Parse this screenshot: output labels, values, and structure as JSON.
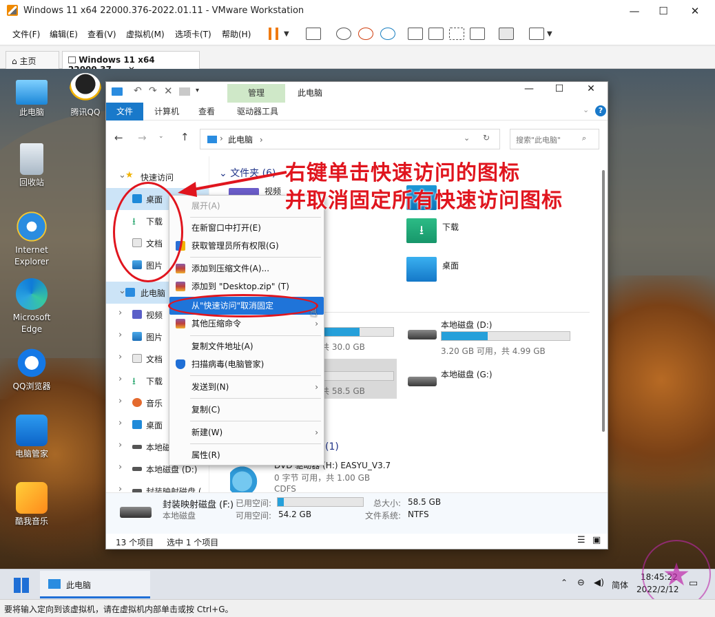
{
  "vm": {
    "title": "Windows 11 x64 22000.376-2022.01.11 - VMware Workstation",
    "menu": [
      "文件(F)",
      "编辑(E)",
      "查看(V)",
      "虚拟机(M)",
      "选项卡(T)",
      "帮助(H)"
    ],
    "tabs": [
      {
        "label": "主页"
      },
      {
        "label": "Windows 11 x64 22000.37..."
      }
    ],
    "status_text": "要将输入定向到该虚拟机，请在虚拟机内部单击或按 Ctrl+G。"
  },
  "desktop": {
    "icons": [
      {
        "label": "此电脑"
      },
      {
        "label": "腾讯QQ"
      },
      {
        "label": "回收站"
      },
      {
        "label": "Internet Explorer"
      },
      {
        "label": "Microsoft Edge"
      },
      {
        "label": "QQ浏览器"
      },
      {
        "label": "电脑管家"
      },
      {
        "label": "酷我音乐"
      }
    ]
  },
  "explorer": {
    "manage_tab": "管理",
    "window_title": "此电脑",
    "ribbon_tabs": [
      "文件",
      "计算机",
      "查看",
      "驱动器工具"
    ],
    "address": "此电脑",
    "search_placeholder": "搜索\"此电脑\"",
    "nav": {
      "quick_access": "快速访问",
      "quick_items": [
        "桌面",
        "下载",
        "文档",
        "图片"
      ],
      "this_pc": "此电脑",
      "pc_items": [
        "视频",
        "图片",
        "文档",
        "下载",
        "音乐",
        "桌面",
        "本地磁",
        "本地磁盘 (D:)",
        "封装映射磁盘 ("
      ]
    },
    "content": {
      "folders_header": "文件夹 (6)",
      "folders": [
        "视频",
        "下载",
        "桌面"
      ],
      "drives": [
        {
          "name": "本地磁盘 (D:)",
          "free": "3.20 GB 可用，共 4.99 GB",
          "used_fraction": 0.36
        },
        {
          "name": "本地磁盘 (G:)"
        }
      ],
      "drive_c_text": "共 30.0 GB",
      "drive_f_text": "共 58.5 GB",
      "dvd_header_fragment": "(1)",
      "dvd_title": "DVD 驱动器 (H:) EASYU_V3.7",
      "dvd_info": "0 字节 可用，共 1.00 GB",
      "dvd_fs": "CDFS"
    },
    "details": {
      "name": "封装映射磁盘 (F:)",
      "type": "本地磁盘",
      "used_label": "已用空间:",
      "free_label": "可用空间:",
      "free_value": "54.2 GB",
      "total_label": "总大小:",
      "total_value": "58.5 GB",
      "fs_label": "文件系统:",
      "fs_value": "NTFS",
      "used_fraction": 0.07
    },
    "status": {
      "count": "13 个项目",
      "selected": "选中 1 个项目"
    }
  },
  "context_menu": {
    "items": [
      {
        "label": "展开(A)",
        "disabled": true
      },
      {
        "label": "在新窗口中打开(E)"
      },
      {
        "label": "获取管理员所有权限(G)",
        "icon": "shield-icon"
      },
      {
        "label": "添加到压缩文件(A)...",
        "icon": "archive-icon"
      },
      {
        "label": "添加到 \"Desktop.zip\" (T)",
        "icon": "archive-icon"
      },
      {
        "label": "从\"快速访问\"取消固定",
        "highlighted": true
      },
      {
        "label": "其他压缩命令",
        "icon": "archive-icon",
        "submenu": true
      },
      {
        "label": "复制文件地址(A)"
      },
      {
        "label": "扫描病毒(电脑管家)",
        "icon": "shield-icon"
      },
      {
        "label": "发送到(N)",
        "submenu": true
      },
      {
        "label": "复制(C)"
      },
      {
        "label": "新建(W)",
        "submenu": true
      },
      {
        "label": "属性(R)"
      }
    ]
  },
  "annotation": {
    "line1": "右键单击快速访问的图标",
    "line2": "并取消固定所有快速访问图标",
    "color": "#e0151e"
  },
  "taskbar": {
    "window_label": "此电脑",
    "ime": "简体",
    "time": "18:45:22",
    "date": "2022/2/12"
  }
}
